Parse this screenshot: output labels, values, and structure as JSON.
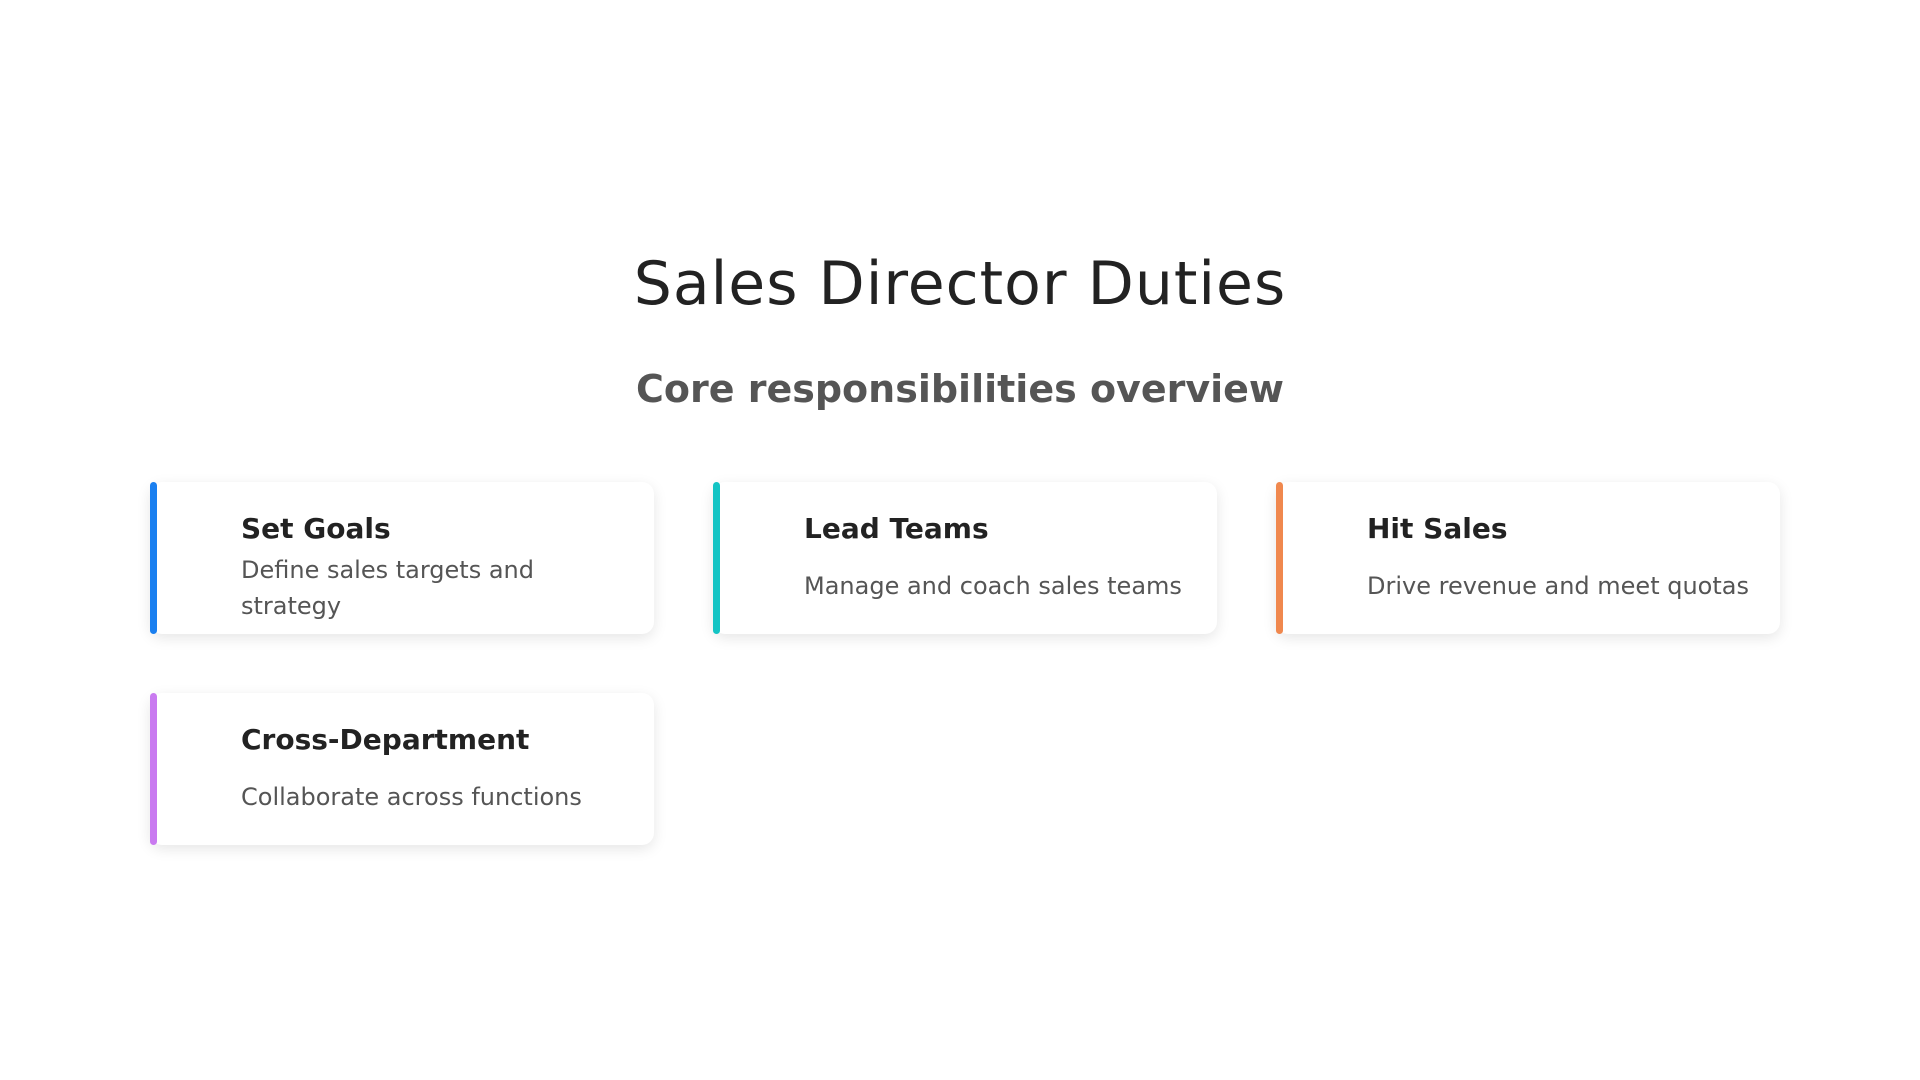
{
  "header": {
    "title": "Sales Director Duties",
    "subtitle": "Core responsibilities overview"
  },
  "cards": [
    {
      "title": "Set Goals",
      "description": "Define sales targets and strategy",
      "accent_color": "#1a7ff0"
    },
    {
      "title": "Lead Teams",
      "description": "Manage and coach sales teams",
      "accent_color": "#14c4c4"
    },
    {
      "title": "Hit Sales",
      "description": "Drive revenue and meet quotas",
      "accent_color": "#f0884e"
    },
    {
      "title": "Cross-Department",
      "description": "Collaborate across functions",
      "accent_color": "#c97af0"
    }
  ]
}
